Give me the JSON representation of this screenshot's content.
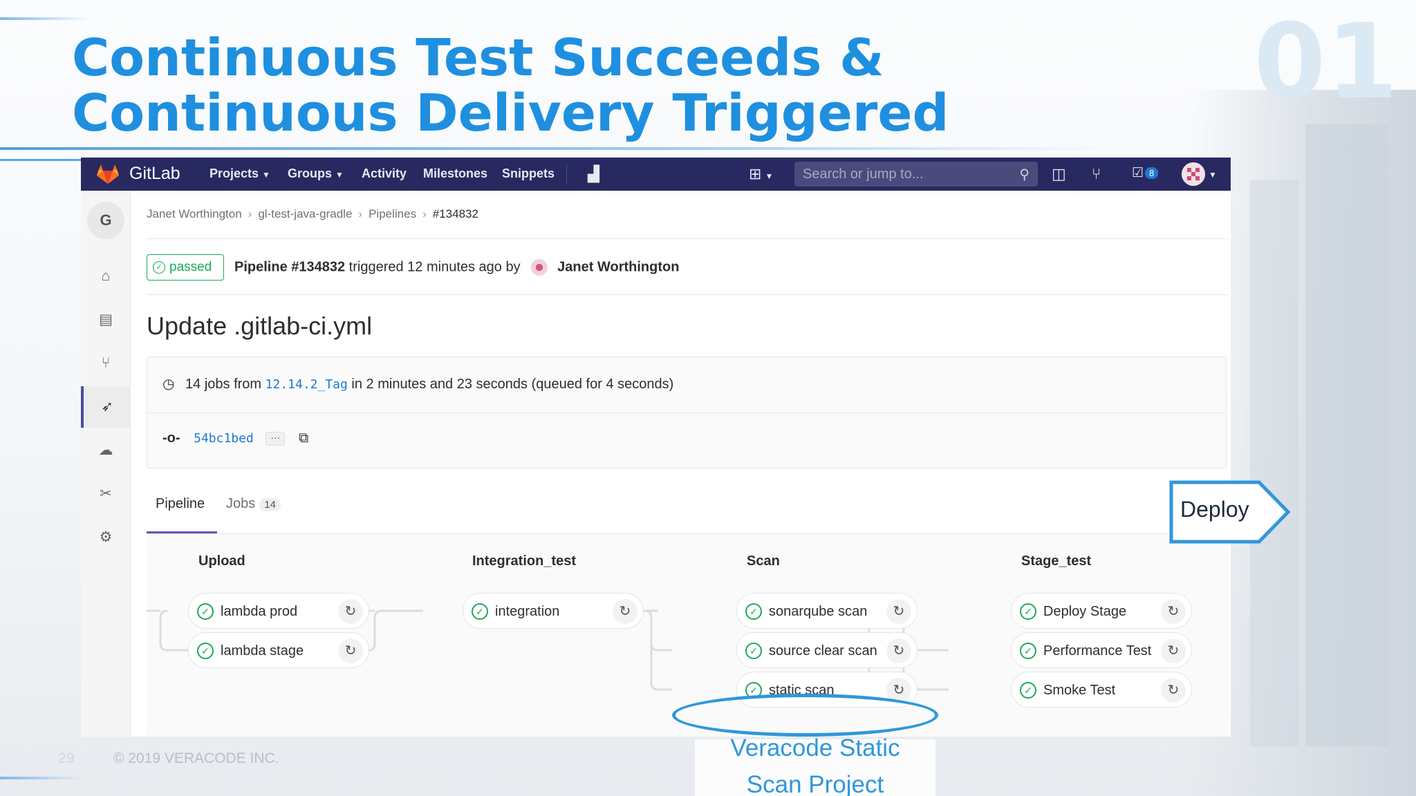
{
  "slide": {
    "title": "Continuous Test Succeeds & Continuous Delivery Triggered",
    "number": "01",
    "page": "29",
    "footer": "© 2019 VERACODE INC."
  },
  "nav": {
    "brand": "GitLab",
    "menu": [
      "Projects",
      "Groups",
      "Activity",
      "Milestones",
      "Snippets"
    ],
    "search_placeholder": "Search or jump to...",
    "todo_count": "8"
  },
  "sidebar": {
    "group_letter": "G"
  },
  "breadcrumb": [
    "Janet Worthington",
    "gl-test-java-gradle",
    "Pipelines",
    "#134832"
  ],
  "pipeline": {
    "status": "passed",
    "label": "Pipeline #134832",
    "triggered_text": "triggered 12 minutes ago by",
    "author": "Janet Worthington",
    "commit_title": "Update .gitlab-ci.yml",
    "jobs_prefix": "14 jobs from",
    "ref": "12.14.2_Tag",
    "jobs_suffix": "in 2 minutes and 23 seconds (queued for 4 seconds)",
    "sha": "54bc1bed"
  },
  "tabs": {
    "pipeline": "Pipeline",
    "jobs": "Jobs",
    "jobs_count": "14"
  },
  "stages": [
    {
      "name": "Upload",
      "jobs": [
        "lambda prod",
        "lambda stage"
      ]
    },
    {
      "name": "Integration_test",
      "jobs": [
        "integration"
      ]
    },
    {
      "name": "Scan",
      "jobs": [
        "sonarqube scan",
        "source clear scan",
        "static scan"
      ]
    },
    {
      "name": "Stage_test",
      "jobs": [
        "Deploy Stage",
        "Performance Test",
        "Smoke Test"
      ]
    }
  ],
  "annotations": {
    "deploy": "Deploy",
    "veracode_line1": "Veracode Static",
    "veracode_line2": "Scan Project"
  },
  "colors": {
    "accent": "#1f8fe0",
    "nav": "#292961",
    "success": "#1aaa55",
    "annotation": "#2f97db"
  }
}
